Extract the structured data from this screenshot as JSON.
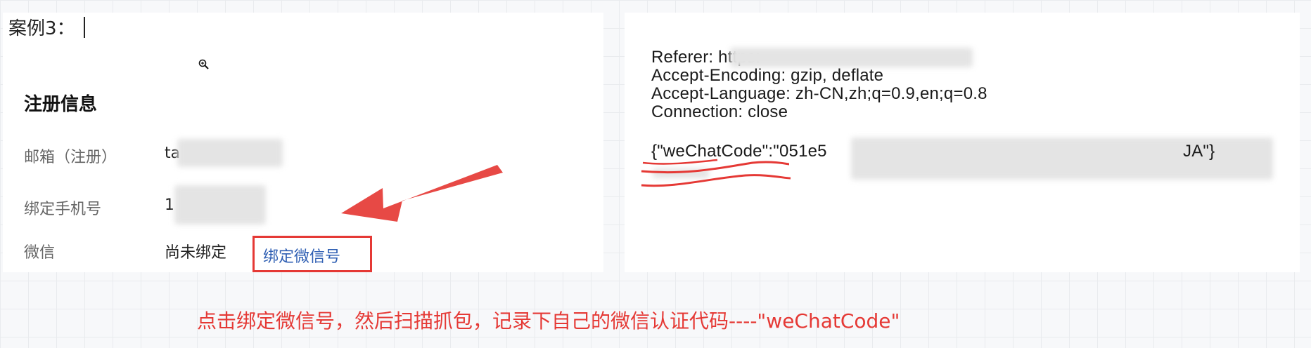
{
  "case_label": "案例3：",
  "registration": {
    "title": "注册信息",
    "rows": [
      {
        "label": "邮箱（注册）",
        "value": "ta"
      },
      {
        "label": "绑定手机号",
        "value": "1"
      },
      {
        "label": "微信",
        "value": "尚未绑定"
      }
    ],
    "bind_wechat_link": "绑定微信号"
  },
  "http_request": {
    "lines": [
      "Referer: https:",
      "Accept-Encoding: gzip, deflate",
      "Accept-Language: zh-CN,zh;q=0.9,en;q=0.8",
      "Connection: close"
    ],
    "body_start": "{\"weChatCode\":\"051e5",
    "body_end": "JA\"}"
  },
  "caption": "点击绑定微信号，然后扫描抓包，记录下自己的微信认证代码----\"weChatCode\"",
  "colors": {
    "annotation_red": "#e53935",
    "link_blue": "#2f5fb3"
  },
  "icons": {
    "zoom": "zoom-in-icon"
  }
}
